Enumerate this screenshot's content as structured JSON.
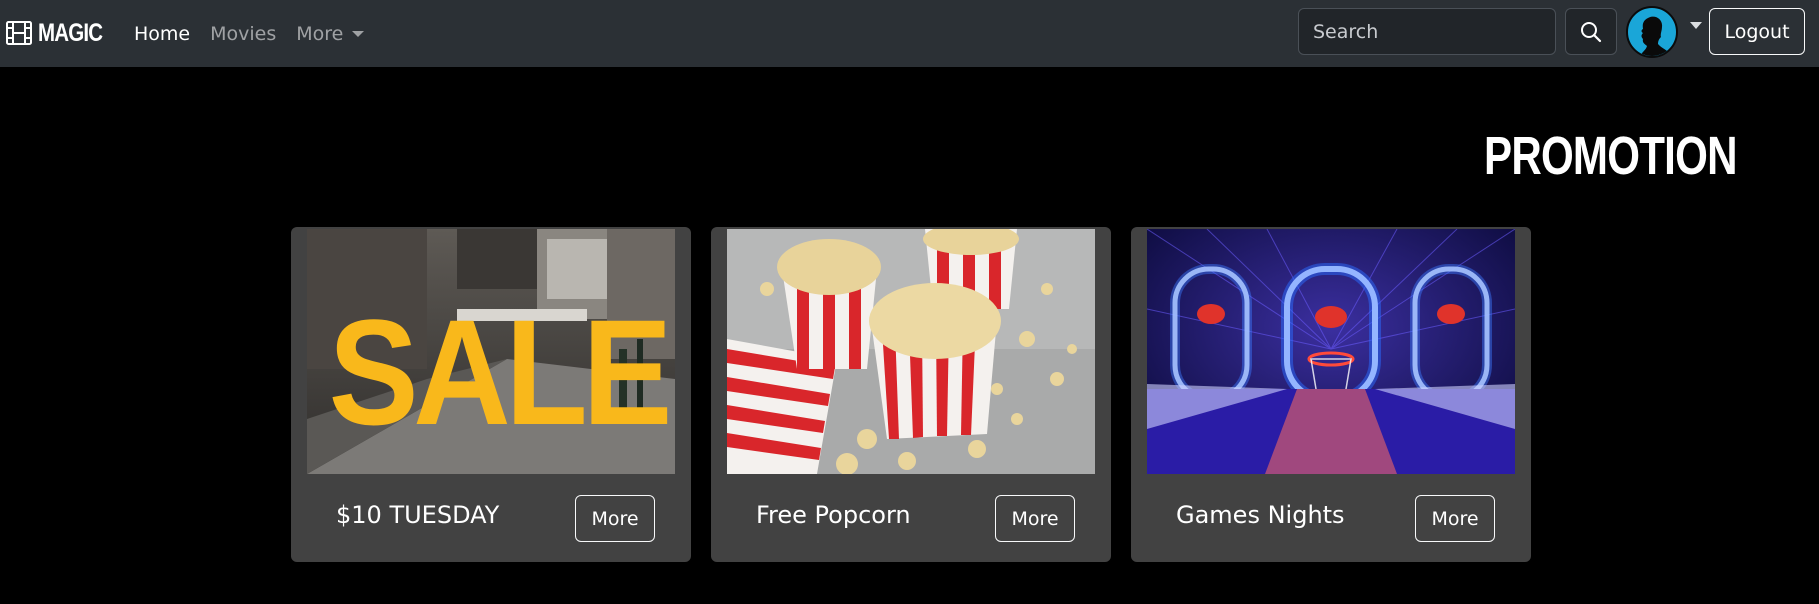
{
  "navbar": {
    "brand": "MAGIC",
    "links": [
      {
        "label": "Home"
      },
      {
        "label": "Movies"
      },
      {
        "label": "More"
      }
    ],
    "search": {
      "placeholder": "Search"
    },
    "logout_label": "Logout"
  },
  "page": {
    "title": "PROMOTION"
  },
  "promotions": [
    {
      "title": "$10 TUESDAY",
      "button": "More",
      "image": "sale-sign-street-image",
      "image_text": "SALE"
    },
    {
      "title": "Free Popcorn",
      "button": "More",
      "image": "popcorn-boxes-image"
    },
    {
      "title": "Games Nights",
      "button": "More",
      "image": "arcade-basketball-image"
    }
  ],
  "colors": {
    "navbar_bg": "#2b3035",
    "page_bg": "#000000",
    "card_bg": "#424242",
    "avatar_bg": "#1aa6d8",
    "sale_yellow": "#f9b81b"
  }
}
